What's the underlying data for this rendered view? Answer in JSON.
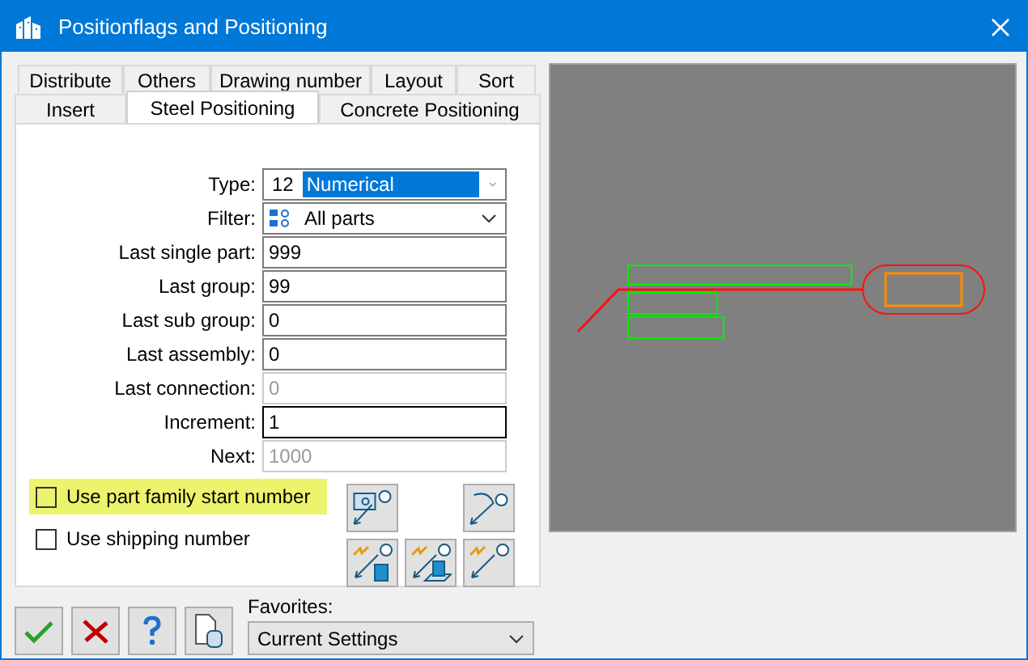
{
  "window": {
    "title": "Positionflags and Positioning"
  },
  "tab_rows": [
    {
      "tabs": [
        {
          "label": "Distribute",
          "selected": false
        },
        {
          "label": "Others",
          "selected": false
        },
        {
          "label": "Drawing number",
          "selected": false
        },
        {
          "label": "Layout",
          "selected": false
        },
        {
          "label": "Sort",
          "selected": false
        }
      ]
    },
    {
      "tabs": [
        {
          "label": "Insert",
          "selected": false
        },
        {
          "label": "Steel Positioning",
          "selected": true
        },
        {
          "label": "Concrete Positioning",
          "selected": false
        }
      ]
    }
  ],
  "fields": [
    {
      "label": "Type:",
      "kind": "dropdown",
      "code": "12",
      "value": "Numerical",
      "highlighted": true,
      "disabled": false,
      "focused": false
    },
    {
      "label": "Filter:",
      "kind": "filter",
      "value": "All parts",
      "highlighted": false,
      "disabled": false,
      "focused": false
    },
    {
      "label": "Last single part:",
      "kind": "text",
      "value": "999",
      "highlighted": false,
      "disabled": false,
      "focused": false
    },
    {
      "label": "Last group:",
      "kind": "text",
      "value": "99",
      "highlighted": false,
      "disabled": false,
      "focused": false
    },
    {
      "label": "Last sub group:",
      "kind": "text",
      "value": "0",
      "highlighted": false,
      "disabled": false,
      "focused": false
    },
    {
      "label": "Last assembly:",
      "kind": "text",
      "value": "0",
      "highlighted": false,
      "disabled": false,
      "focused": false
    },
    {
      "label": "Last connection:",
      "kind": "text",
      "value": "0",
      "highlighted": false,
      "disabled": true,
      "focused": false
    },
    {
      "label": "Increment:",
      "kind": "text",
      "value": "1",
      "highlighted": false,
      "disabled": false,
      "focused": true
    },
    {
      "label": "Next:",
      "kind": "text",
      "value": "1000",
      "highlighted": false,
      "disabled": true,
      "focused": false
    }
  ],
  "checkboxes": [
    {
      "label": "Use part family start number",
      "checked": false,
      "highlighted": true
    },
    {
      "label": "Use shipping number",
      "checked": false,
      "highlighted": false
    }
  ],
  "favorites": {
    "label": "Favorites:",
    "value": "Current Settings"
  }
}
